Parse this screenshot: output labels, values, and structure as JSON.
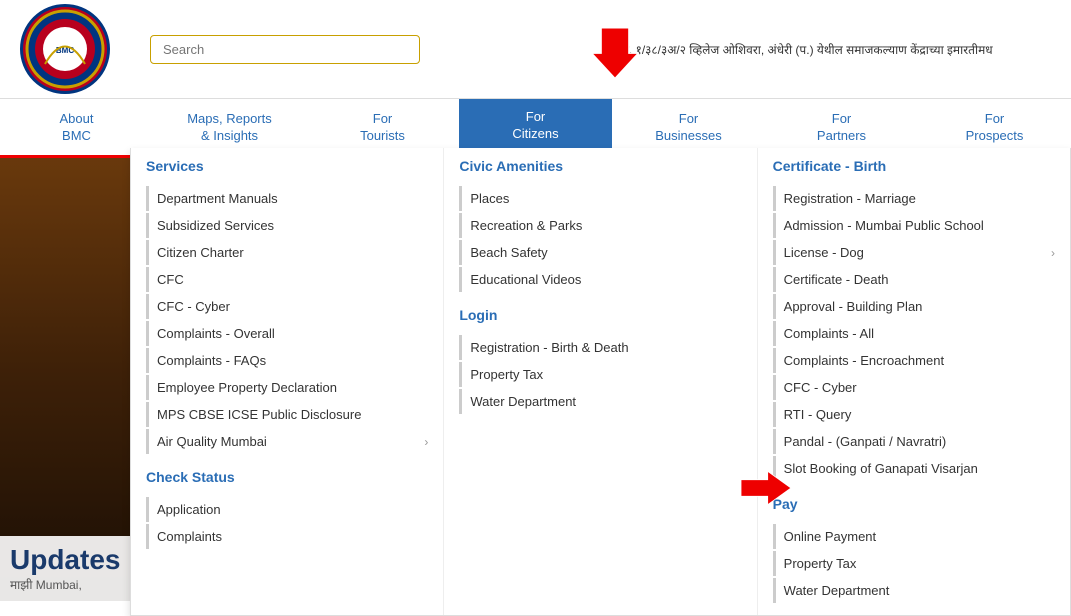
{
  "header": {
    "search_placeholder": "Search",
    "ticker_text": "भू. १/३८/३अ/२ व्हिलेज ओशिवरा, अंधेरी (प.) येथील समाजकल्याण केंद्राच्या इमारतीमध"
  },
  "nav": {
    "items": [
      {
        "id": "about",
        "line1": "About",
        "line2": "BMC"
      },
      {
        "id": "maps",
        "line1": "Maps, Reports",
        "line2": "& Insights"
      },
      {
        "id": "tourists",
        "line1": "For",
        "line2": "Tourists"
      },
      {
        "id": "citizens",
        "line1": "For",
        "line2": "Citizens",
        "active": true
      },
      {
        "id": "businesses",
        "line1": "For",
        "line2": "Businesses"
      },
      {
        "id": "partners",
        "line1": "For",
        "line2": "Partners"
      },
      {
        "id": "prospects",
        "line1": "For",
        "line2": "Prospects"
      }
    ]
  },
  "dropdown": {
    "col1": {
      "title": "Services",
      "items": [
        "Department Manuals",
        "Subsidized Services",
        "Citizen Charter",
        "CFC",
        "CFC - Cyber",
        "Complaints - Overall",
        "Complaints - FAQs",
        "Employee Property Declaration",
        "MPS CBSE ICSE Public Disclosure",
        "Air Quality Mumbai"
      ],
      "has_chevron": [
        false,
        false,
        false,
        false,
        false,
        false,
        false,
        false,
        false,
        true
      ]
    },
    "col2": {
      "title": "Civic Amenities",
      "items": [
        "Places",
        "Recreation & Parks",
        "Beach Safety",
        "Educational Videos"
      ],
      "has_chevron": [
        false,
        false,
        false,
        false
      ]
    },
    "col3": {
      "title": "Certificate - Birth",
      "items": [
        "Registration - Marriage",
        "Admission - Mumbai Public School",
        "License - Dog",
        "Certificate - Death",
        "Approval - Building Plan",
        "Complaints - All",
        "Complaints - Encroachment",
        "CFC - Cyber",
        "RTI - Query",
        "Pandal - (Ganpati / Navratri)",
        "Slot Booking of Ganapati Visarjan"
      ],
      "has_chevron": [
        false,
        false,
        true,
        false,
        false,
        false,
        false,
        false,
        false,
        false,
        false
      ]
    }
  },
  "check_status": {
    "title": "Check Status",
    "items": [
      "Application",
      "Complaints"
    ]
  },
  "login": {
    "title": "Login",
    "items": [
      "Registration - Birth & Death",
      "Property Tax",
      "Water Department"
    ]
  },
  "pay": {
    "title": "Pay",
    "items": [
      "Online Payment",
      "Property Tax",
      "Water Department"
    ]
  },
  "updates": {
    "title": "Updates",
    "item": "माझी Mumbai,"
  }
}
